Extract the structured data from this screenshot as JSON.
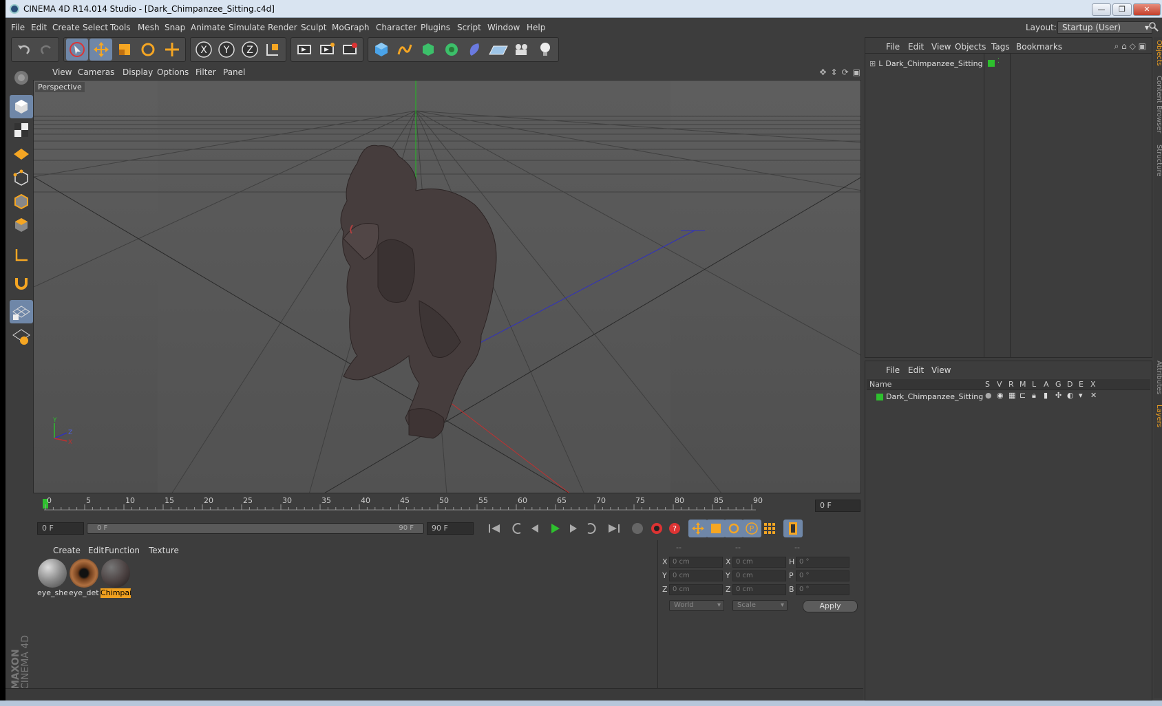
{
  "window": {
    "title": "CINEMA 4D R14.014 Studio - [Dark_Chimpanzee_Sitting.c4d]",
    "btn_min": "—",
    "btn_max": "❐",
    "btn_close": "✕"
  },
  "menubar": {
    "items": [
      "File",
      "Edit",
      "Create",
      "Select",
      "Tools",
      "Mesh",
      "Snap",
      "Animate",
      "Simulate",
      "Render",
      "Sculpt",
      "MoGraph",
      "Character",
      "Plugins",
      "Script",
      "Window",
      "Help"
    ],
    "layout_label": "Layout:",
    "layout_value": "Startup (User)"
  },
  "viewport": {
    "menu": [
      "View",
      "Cameras",
      "Display",
      "Options",
      "Filter",
      "Panel"
    ],
    "camera_label": "Perspective",
    "axis_y": "Y",
    "axis_x": "X",
    "axis_z": "Z"
  },
  "timeline": {
    "ticks": [
      "0",
      "5",
      "10",
      "15",
      "20",
      "25",
      "30",
      "35",
      "40",
      "45",
      "50",
      "55",
      "60",
      "65",
      "70",
      "75",
      "80",
      "85",
      "90"
    ],
    "current_frame": "0 F"
  },
  "controls": {
    "start_frame": "0 F",
    "range_start": "0 F",
    "range_end": "90 F",
    "end_frame": "90 F"
  },
  "materials": {
    "menu": [
      "Create",
      "Edit",
      "Function",
      "Texture"
    ],
    "items": [
      {
        "label": "eye_she",
        "color": "#8a8a8a"
      },
      {
        "label": "eye_deti",
        "color": "#6a3a1a"
      },
      {
        "label": "Chimpai",
        "color": "#4a4040"
      }
    ]
  },
  "coordinates": {
    "headers": [
      "--",
      "--",
      "--"
    ],
    "rows": [
      {
        "l1": "X",
        "v1": "0 cm",
        "l2": "X",
        "v2": "0 cm",
        "l3": "H",
        "v3": "0 °"
      },
      {
        "l1": "Y",
        "v1": "0 cm",
        "l2": "Y",
        "v2": "0 cm",
        "l3": "P",
        "v3": "0 °"
      },
      {
        "l1": "Z",
        "v1": "0 cm",
        "l2": "Z",
        "v2": "0 cm",
        "l3": "B",
        "v3": "0 °"
      }
    ],
    "space": "World",
    "mode": "Scale",
    "apply": "Apply"
  },
  "objects_panel": {
    "menu": [
      "File",
      "Edit",
      "View",
      "Objects",
      "Tags",
      "Bookmarks"
    ],
    "object_name": "Dark_Chimpanzee_Sitting"
  },
  "layers_panel": {
    "menu": [
      "File",
      "Edit",
      "View"
    ],
    "columns": [
      "Name",
      "S",
      "V",
      "R",
      "M",
      "L",
      "A",
      "G",
      "D",
      "E",
      "X"
    ],
    "layer_name": "Dark_Chimpanzee_Sitting"
  },
  "side_tabs": [
    "Objects",
    "Content Browser",
    "Structure",
    "Attributes",
    "Layers"
  ],
  "brand": {
    "line1": "MAXON",
    "line2": "CINEMA 4D"
  },
  "colors": {
    "accent": "#f0a020",
    "active_tool": "#6f87a8",
    "layer_green": "#2ec02e"
  }
}
